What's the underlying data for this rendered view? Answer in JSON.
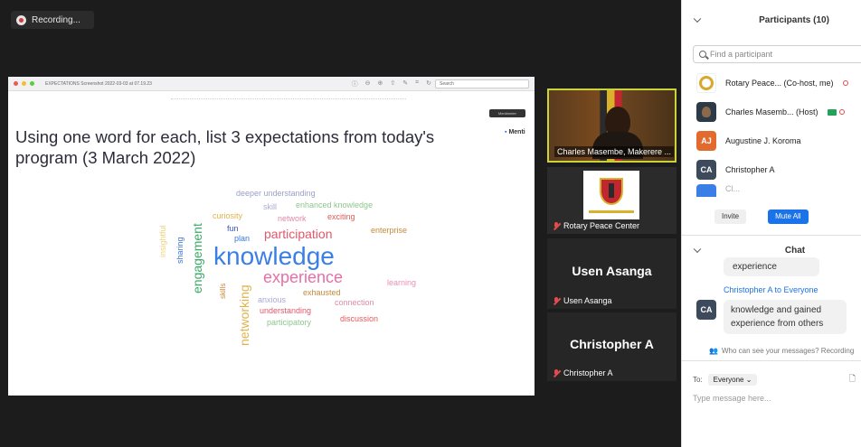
{
  "recording": {
    "label": "Recording..."
  },
  "share": {
    "window_title": "EXPECTATIONS Screenshot 2022-03-03 at 07.19.23",
    "search_placeholder": "Search",
    "badge": "Mentimeter",
    "brand": "Menti",
    "question": "Using one word for each, list 3 expectations from today's program (3 March 2022)",
    "words": [
      {
        "text": "deeper understanding",
        "color": "#9aa0c8",
        "size": 9
      },
      {
        "text": "enhanced knowledge",
        "color": "#8fc58f",
        "size": 9
      },
      {
        "text": "skill",
        "color": "#a9a9d8",
        "size": 9
      },
      {
        "text": "curiosity",
        "color": "#e0b44a",
        "size": 9
      },
      {
        "text": "network",
        "color": "#e08aa8",
        "size": 9
      },
      {
        "text": "exciting",
        "color": "#e35a5a",
        "size": 9
      },
      {
        "text": "fun",
        "color": "#3355cc",
        "size": 9
      },
      {
        "text": "plan",
        "color": "#3b77d8",
        "size": 9
      },
      {
        "text": "participation",
        "color": "#e2576a",
        "size": 14
      },
      {
        "text": "enterprise",
        "color": "#c8893a",
        "size": 9
      },
      {
        "text": "knowledge",
        "color": "#3a7fe5",
        "size": 28
      },
      {
        "text": "experience",
        "color": "#e66fa8",
        "size": 18
      },
      {
        "text": "learning",
        "color": "#e88fb5",
        "size": 9
      },
      {
        "text": "exhausted",
        "color": "#c8893a",
        "size": 9
      },
      {
        "text": "anxious",
        "color": "#a9a9d8",
        "size": 9
      },
      {
        "text": "connection",
        "color": "#e08aa8",
        "size": 9
      },
      {
        "text": "understanding",
        "color": "#e2576a",
        "size": 9
      },
      {
        "text": "participatory",
        "color": "#8fc58f",
        "size": 9
      },
      {
        "text": "discussion",
        "color": "#e35a5a",
        "size": 9
      },
      {
        "text": "insightful",
        "color": "#f0d27a",
        "size": 9
      },
      {
        "text": "sharing",
        "color": "#3b77d8",
        "size": 9
      },
      {
        "text": "engagement",
        "color": "#3aaa66",
        "size": 14
      },
      {
        "text": "skills",
        "color": "#c8893a",
        "size": 8
      },
      {
        "text": "networking",
        "color": "#e0b44a",
        "size": 14
      }
    ]
  },
  "tiles": [
    {
      "name": "Charles Masembe, Makerere ...",
      "big": ""
    },
    {
      "name": "Rotary Peace Center",
      "big": ""
    },
    {
      "name": "Usen Asanga",
      "big": "Usen Asanga"
    },
    {
      "name": "Christopher A",
      "big": "Christopher A"
    }
  ],
  "participants": {
    "title": "Participants (10)",
    "search_placeholder": "Find a participant",
    "list": [
      {
        "name": "Rotary Peace... (Co-host, me)",
        "initials": "",
        "color": "#ffffff"
      },
      {
        "name": "Charles Masemb... (Host)",
        "initials": "",
        "color": "#3a3a3a"
      },
      {
        "name": "Augustine J. Koroma",
        "initials": "AJ",
        "color": "#e36a2e"
      },
      {
        "name": "Christopher A",
        "initials": "CA",
        "color": "#3d4a5c"
      },
      {
        "name": "Cl...",
        "initials": "",
        "color": "#3a7fe5"
      }
    ],
    "invite": "Invite",
    "mute_all": "Mute All"
  },
  "chat": {
    "title": "Chat",
    "msg1": "experience",
    "from2": "Christopher  A to Everyone",
    "avatar2": "CA",
    "msg2": "knowledge and gained experience from others",
    "who_can_see": "Who can see your messages? Recording",
    "to_label": "To:",
    "to_value": "Everyone",
    "type_placeholder": "Type message here..."
  }
}
